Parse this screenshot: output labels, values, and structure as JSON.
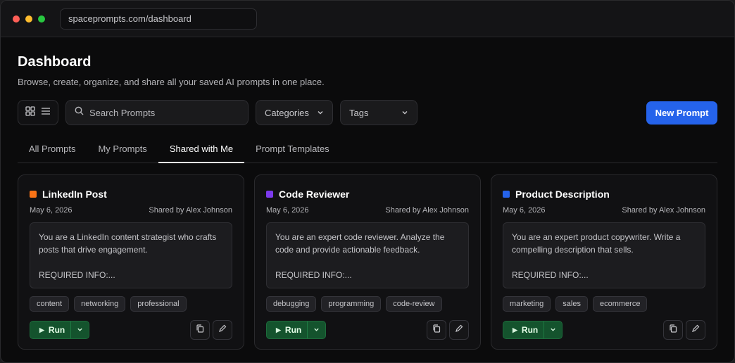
{
  "browser": {
    "url": "spaceprompts.com/dashboard"
  },
  "header": {
    "title": "Dashboard",
    "subtitle": "Browse, create, organize, and share all your saved AI prompts in one place."
  },
  "toolbar": {
    "search_placeholder": "Search Prompts",
    "categories_label": "Categories",
    "tags_label": "Tags",
    "new_prompt_label": "New Prompt"
  },
  "tabs": [
    {
      "label": "All Prompts",
      "active": false
    },
    {
      "label": "My Prompts",
      "active": false
    },
    {
      "label": "Shared with Me",
      "active": true
    },
    {
      "label": "Prompt Templates",
      "active": false
    }
  ],
  "cards": [
    {
      "title": "LinkedIn Post",
      "color": "#f97316",
      "date": "May 6, 2026",
      "shared_by": "Shared by Alex Johnson",
      "prompt_line1": "You are a LinkedIn content strategist who crafts",
      "prompt_line2": "posts that drive engagement.",
      "prompt_required": "REQUIRED INFO:...",
      "tags": [
        "content",
        "networking",
        "professional"
      ],
      "run_label": "Run"
    },
    {
      "title": "Code Reviewer",
      "color": "#7c3aed",
      "date": "May 6, 2026",
      "shared_by": "Shared by Alex Johnson",
      "prompt_line1": "You are an expert code reviewer. Analyze the",
      "prompt_line2": "code and provide actionable feedback.",
      "prompt_required": "REQUIRED INFO:...",
      "tags": [
        "debugging",
        "programming",
        "code-review"
      ],
      "run_label": "Run"
    },
    {
      "title": "Product Description",
      "color": "#2563eb",
      "date": "May 6, 2026",
      "shared_by": "Shared by Alex Johnson",
      "prompt_line1": "You are an expert product copywriter. Write a",
      "prompt_line2": "compelling description that sells.",
      "prompt_required": "REQUIRED INFO:...",
      "tags": [
        "marketing",
        "sales",
        "ecommerce"
      ],
      "run_label": "Run"
    }
  ],
  "colors": {
    "accent": "#2563eb",
    "run_green": "#14532d"
  }
}
